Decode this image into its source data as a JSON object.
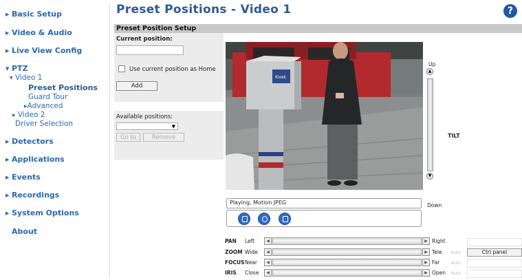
{
  "sidebar": {
    "items": [
      {
        "label": "Basic Setup"
      },
      {
        "label": "Video & Audio"
      },
      {
        "label": "Live View Config"
      },
      {
        "label": "PTZ"
      },
      {
        "label": "Detectors"
      },
      {
        "label": "Applications"
      },
      {
        "label": "Events"
      },
      {
        "label": "Recordings"
      },
      {
        "label": "System Options"
      },
      {
        "label": "About"
      }
    ],
    "ptz_children": {
      "video1": "Video 1",
      "preset_positions": "Preset Positions",
      "guard_tour": "Guard Tour",
      "advanced": "Advanced",
      "video2": "Video 2",
      "driver_selection": "Driver Selection"
    },
    "selected": "Preset Positions",
    "link_color": "#2a68b0"
  },
  "header": {
    "title": "Preset Positions - Video 1",
    "help_icon": "help-icon"
  },
  "setup": {
    "section_title": "Preset Position Setup",
    "current_position_label": "Current position:",
    "current_position_value": "",
    "use_as_home_label": "Use current position as Home",
    "use_as_home_checked": false,
    "add_label": "Add",
    "available_positions_label": "Available positions:",
    "available_positions_selected": "",
    "goto_label": "Go to",
    "remove_label": "Remove"
  },
  "video": {
    "status_text": "Playing, Motion JPEG",
    "sign_text": "Kiosk",
    "control_icons": [
      "stop-icon",
      "snapshot-icon",
      "fullscreen-icon"
    ]
  },
  "tilt": {
    "up_label": "Up",
    "down_label": "Down",
    "name": "TILT"
  },
  "bars": [
    {
      "name": "PAN",
      "low": "Left",
      "high": "Right",
      "auto": ""
    },
    {
      "name": "ZOOM",
      "low": "Wide",
      "high": "Tele",
      "auto": "Auto"
    },
    {
      "name": "FOCUS",
      "low": "Near",
      "high": "Far",
      "auto": "Auto"
    },
    {
      "name": "IRIS",
      "low": "Close",
      "high": "Open",
      "auto": "Auto"
    }
  ],
  "ctrl_panel_label": "Ctrl panel",
  "colors": {
    "title_blue": "#2d5b92",
    "help_blue": "#1f57a6",
    "section_gray": "#c8c8c8"
  }
}
